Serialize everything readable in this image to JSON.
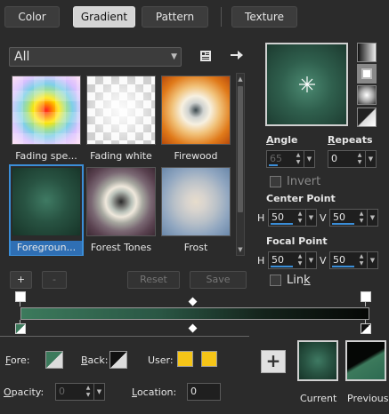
{
  "tabs": [
    {
      "label": "Color",
      "active": false
    },
    {
      "label": "Gradient",
      "active": true
    },
    {
      "label": "Pattern",
      "active": false
    },
    {
      "label": "Texture",
      "active": false
    }
  ],
  "filter": {
    "value": "All"
  },
  "thumbnails": [
    {
      "label": "Fading spe...",
      "selected": false
    },
    {
      "label": "Fading white",
      "selected": false
    },
    {
      "label": "Firewood",
      "selected": false
    },
    {
      "label": "Foregroun...",
      "selected": true
    },
    {
      "label": "Forest Tones",
      "selected": false
    },
    {
      "label": "Frost",
      "selected": false
    }
  ],
  "list_buttons": {
    "add": "+",
    "remove": "-",
    "reset": "Reset",
    "save": "Save"
  },
  "angle": {
    "label": "Angle",
    "value": "65"
  },
  "repeats": {
    "label": "Repeats",
    "value": "0"
  },
  "invert": {
    "label": "Invert",
    "checked": false
  },
  "center_point": {
    "label": "Center Point",
    "h_label": "H",
    "h": "50",
    "v_label": "V",
    "v": "50"
  },
  "focal_point": {
    "label": "Focal Point",
    "h_label": "H",
    "h": "50",
    "v_label": "V",
    "v": "50"
  },
  "link": {
    "label": "Link",
    "checked": false
  },
  "bottom": {
    "fore_label": "Fore:",
    "back_label": "Back:",
    "user_label": "User:",
    "opacity_label": "Opacity:",
    "opacity_value": "0",
    "location_label": "Location:",
    "location_value": "0",
    "add_button": "+",
    "current_label": "Current",
    "previous_label": "Previous"
  },
  "colors": {
    "accent": "#3b8ed8",
    "gradient_start": "#3c7a5c",
    "gradient_end": "#050705",
    "user_swatch": "#f5c518"
  },
  "icons": [
    "library-icon",
    "arrow-right-icon",
    "sunburst-icon",
    "linear-style-icon",
    "rectangular-style-icon",
    "radial-style-icon",
    "sunburst-style-icon"
  ]
}
